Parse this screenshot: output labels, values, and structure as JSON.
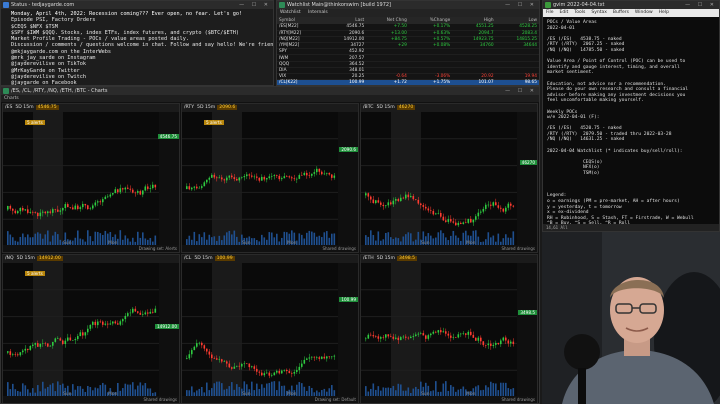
{
  "notepad": {
    "title": "Status - tedjaygarde.com",
    "lines": [
      "Monday, April 4th, 2022: Recession coming??? Ever open, no fear. Let's go!",
      "Episode PSI, Factory Orders",
      "$CEQS $NFX $TSM",
      "$SPY $IWM $QQQ. Stocks, index ETFs, index futures, and crypto ($BTC/$ETH)",
      "Market Profile Trading - POCs / value areas posted daily.",
      "Discussion / comments / questions welcome in chat. Follow and say hello! We're friendly.",
      "",
      "@mkjaygarde.com on the InterWebs",
      "@mrk_jay_sarde on Instagram",
      "@jayderevilive on TikTok",
      "@MrKayGarde on Twitter",
      "@jayderevilive on Twitch",
      "@jaygarde on Facebook"
    ]
  },
  "watchlist": {
    "title": "Watchlist Main@thinkorswim [build 1972]",
    "menu": [
      "Watchlist",
      "Internals"
    ],
    "columns": [
      "Symbol",
      "Last",
      "Net Chng",
      "%Change",
      "High",
      "Low"
    ],
    "rows": [
      {
        "sym": "/ES[M22]",
        "last": "4546.75",
        "chg": "+7.50",
        "pct": "+0.17%",
        "high": "4551.25",
        "low": "4528.25",
        "dir": "pos"
      },
      {
        "sym": "/RTY[M22]",
        "last": "2090.6",
        "chg": "+13.00",
        "pct": "+0.63%",
        "high": "2094.7",
        "low": "2083.4",
        "dir": "pos"
      },
      {
        "sym": "/NQ[M22]",
        "last": "14912.00",
        "chg": "+84.75",
        "pct": "+0.57%",
        "high": "14923.75",
        "low": "14815.25",
        "dir": "pos"
      },
      {
        "sym": "/YM[M22]",
        "last": "34727",
        "chg": "+29",
        "pct": "+0.08%",
        "high": "34760",
        "low": "34644",
        "dir": "pos"
      },
      {
        "sym": "SPY",
        "last": "452.92",
        "chg": "",
        "pct": "",
        "high": "",
        "low": "",
        "dir": ""
      },
      {
        "sym": "IWM",
        "last": "207.57",
        "chg": "",
        "pct": "",
        "high": "",
        "low": "",
        "dir": ""
      },
      {
        "sym": "QQQ",
        "last": "364.52",
        "chg": "",
        "pct": "",
        "high": "",
        "low": "",
        "dir": ""
      },
      {
        "sym": "DIA",
        "last": "348.01",
        "chg": "",
        "pct": "",
        "high": "",
        "low": "",
        "dir": ""
      },
      {
        "sym": "VIX",
        "last": "20.25",
        "chg": "-0.64",
        "pct": "-3.06%",
        "high": "20.92",
        "low": "19.94",
        "dir": "neg"
      },
      {
        "sym": "/CL[K22]",
        "last": "100.99",
        "chg": "+1.72",
        "pct": "+1.75%",
        "high": "101.07",
        "low": "98.65",
        "dir": "pos",
        "sel": true
      }
    ]
  },
  "notes": {
    "title": "gvim 2022-04-04.txt",
    "menu": [
      "File",
      "Edit",
      "Tools",
      "Syntax",
      "Buffers",
      "Window",
      "Help"
    ],
    "body": "POCs / Value Areas\n2022-04-01\n\n/ES (/ES)   4538.75 - naked\n/RTY (/RTY)  2067.25 - naked\n/NQ (/NQ)   14785.50 - naked\n\nValue Area / Point of Control (POC) can be used to\nidentify and gauge interest, timing, and overall\nmarket sentiment.\n\nEducation, not advice nor a recommendation.\nPlease do your own research and consult a financial\nadvisor before making any investment decisions you\nfeel uncomfortable making yourself.\n\nWeekly POCs\nw/e 2022-04-01 (F):\n\n/ES (/ES)   4520.75 - naked\n/RTY (/RTY)  2079.50 - traded thru 2022-03-28\n/NQ (/NQ)   14631.25 - naked\n\n2022-04-04 Watchlist (* indicates buy/sell/roll):\n\n             CEQS(o)\n             NFX(o)\n             TSM(o)\n\n\n\nLegend:\no = earnings (PM = pre-market, AH = after hours)\ny = yesterday, t = tomorrow\nx = ex-dividend\nRH = Robinhood, S = Stash, FT = Firstrade, W = Webull\n^B = Buy, ^S = Sell, ^R = Roll",
    "status": "14,61        All"
  },
  "charts": {
    "title": "/ES, /CL, /RTY, /NQ, /ETH, /BTC - Charts",
    "strip": "Charts",
    "panes": [
      {
        "sym": "/ES",
        "tf": "5D 15m",
        "price": "4546.75",
        "alert": "5 alerts",
        "foot": "Drawing set: Alerts",
        "color": "#3fbf3f"
      },
      {
        "sym": "/RTY",
        "tf": "5D 15m",
        "price": "2090.6",
        "alert": "5 alerts",
        "foot": "Shared drawings",
        "color": "#3fbf3f"
      },
      {
        "sym": "/BTC",
        "tf": "5D 15m",
        "price": "46270",
        "alert": "",
        "foot": "Shared drawings",
        "color": "#3fbf3f"
      },
      {
        "sym": "/NQ",
        "tf": "5D 15m",
        "price": "14912.00",
        "alert": "5 alerts",
        "foot": "Shared drawings",
        "color": "#3fbf3f"
      },
      {
        "sym": "/CL",
        "tf": "5D 15m",
        "price": "100.99",
        "alert": "",
        "foot": "Drawing set: Default",
        "color": "#3fbf3f"
      },
      {
        "sym": "/ETH",
        "tf": "5D 15m",
        "price": "3498.5",
        "alert": "",
        "foot": "Shared drawings",
        "color": "#3fbf3f"
      }
    ],
    "day_labels": [
      "Sun",
      "Mon"
    ]
  }
}
